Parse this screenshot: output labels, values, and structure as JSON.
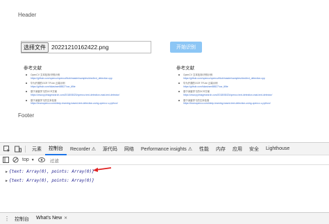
{
  "page": {
    "header": "Header",
    "footer": "Footer",
    "file_button": "选择文件",
    "file_name": "20221210162422.png",
    "submit_label": "开始识别"
  },
  "refs_left": {
    "title": "参考文献",
    "items": [
      {
        "text": "OpenCV 文本检测/识别示例",
        "link": "https://github.com/opencv/opencv/blob/master/samples/dnn/text_detection.cpp"
      },
      {
        "text": "华为开源的OCR TFLite 云端示例",
        "link": "https://github.com/tulasiram58827/ocr_tflite"
      },
      {
        "text": "基于深度学习的OCR方案",
        "link": "https://www.pyimagesearch.com/2018/08/20/opencv-text-detection-east-text-detector/"
      },
      {
        "text": "基于深度学习的文本检测",
        "link": "https://learnopencv.com/deep-learning-based-text-detection-using-opencv-c-python/"
      }
    ]
  },
  "refs_right": {
    "title": "参考文献",
    "items": [
      {
        "text": "OpenCV 文本检测/识别示例",
        "link": "https://github.com/opencv/opencv/blob/master/samples/dnn/text_detection.cpp"
      },
      {
        "text": "华为开源的OCR TFLite 云端示例",
        "link": "https://github.com/tulasiram58827/ocr_tflite"
      },
      {
        "text": "基于深度学习的OCR方案",
        "link": "https://www.pyimagesearch.com/2018/08/20/opencv-text-detection-east-text-detector/"
      },
      {
        "text": "基于深度学习的文本检测",
        "link": "https://learnopencv.com/deep-learning-based-text-detection-using-opencv-c-python/"
      }
    ]
  },
  "devtools": {
    "tabs": [
      "元素",
      "控制台",
      "Recorder ⚠",
      "源代码",
      "网络",
      "Performance insights ⚠",
      "性能",
      "内存",
      "应用",
      "安全",
      "Lighthouse"
    ],
    "filter_context": "top",
    "filter_placeholder": "过滤",
    "console_lines": [
      "{text: Array(0), points: Array(0)}",
      "{text: Array(0), points: Array(0)}"
    ],
    "drawer_tabs": [
      "控制台",
      "What's New"
    ],
    "accent_color": "#1a73e8",
    "arrow_color": "#e02020"
  }
}
